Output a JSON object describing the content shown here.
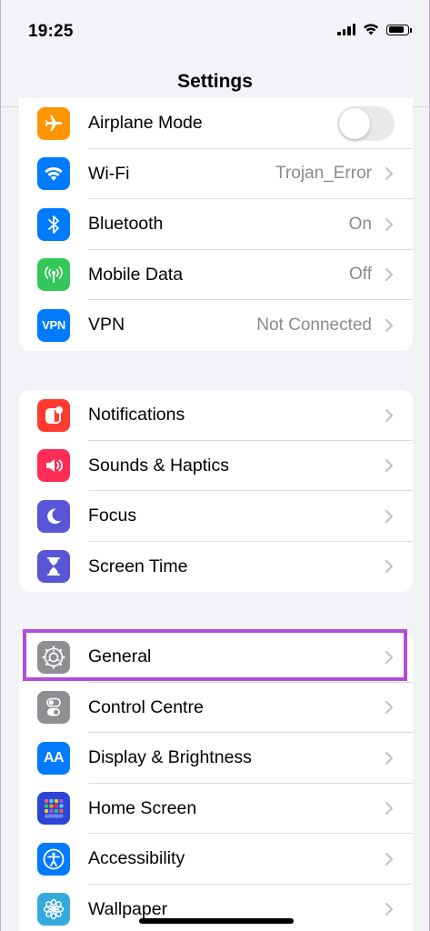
{
  "status_bar": {
    "time": "19:25"
  },
  "nav": {
    "title": "Settings"
  },
  "groups": [
    {
      "items": [
        {
          "label": "Airplane Mode",
          "toggle": "off",
          "icon": "airplane-icon",
          "color": "#ff9500"
        },
        {
          "label": "Wi-Fi",
          "value": "Trojan_Error",
          "icon": "wifi-icon",
          "color": "#007aff"
        },
        {
          "label": "Bluetooth",
          "value": "On",
          "icon": "bluetooth-icon",
          "color": "#007aff"
        },
        {
          "label": "Mobile Data",
          "value": "Off",
          "icon": "antenna-icon",
          "color": "#34c759"
        },
        {
          "label": "VPN",
          "value": "Not Connected",
          "icon": "vpn-icon",
          "icon_text": "VPN",
          "color": "#007aff"
        }
      ]
    },
    {
      "items": [
        {
          "label": "Notifications",
          "icon": "notifications-icon",
          "color": "#ff3b30"
        },
        {
          "label": "Sounds & Haptics",
          "icon": "speaker-icon",
          "color": "#ff2d55"
        },
        {
          "label": "Focus",
          "icon": "moon-icon",
          "color": "#5856d6"
        },
        {
          "label": "Screen Time",
          "icon": "hourglass-icon",
          "color": "#5856d6"
        }
      ]
    },
    {
      "items": [
        {
          "label": "General",
          "icon": "gear-icon",
          "color": "#8e8e93",
          "highlighted": true
        },
        {
          "label": "Control Centre",
          "icon": "toggles-icon",
          "color": "#8e8e93"
        },
        {
          "label": "Display & Brightness",
          "icon": "text-size-icon",
          "icon_text": "AA",
          "color": "#007aff"
        },
        {
          "label": "Home Screen",
          "icon": "home-grid-icon",
          "color": "#2b45d6"
        },
        {
          "label": "Accessibility",
          "icon": "accessibility-icon",
          "color": "#007aff"
        },
        {
          "label": "Wallpaper",
          "icon": "flower-icon",
          "color": "#34aadc"
        }
      ]
    }
  ],
  "colors": {
    "highlight": "#b24cd9",
    "background": "#f2f2f7",
    "secondary_text": "#8a8a8e"
  }
}
